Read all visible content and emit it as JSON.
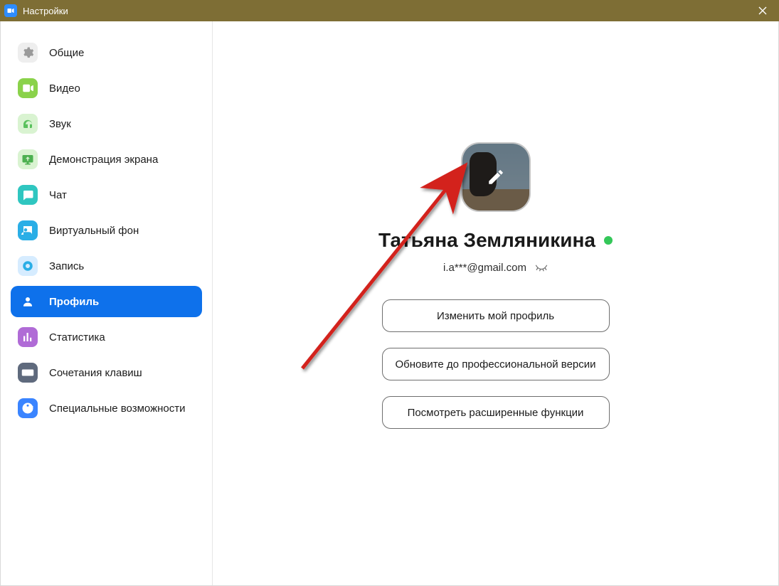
{
  "window": {
    "title": "Настройки"
  },
  "sidebar": {
    "items": [
      {
        "id": "general",
        "label": "Общие",
        "icon": "gear",
        "color": "#eeeeee",
        "glyph": "#9a9a9a"
      },
      {
        "id": "video",
        "label": "Видео",
        "icon": "video",
        "color": "#8ad24a",
        "glyph": "#ffffff"
      },
      {
        "id": "audio",
        "label": "Звук",
        "icon": "headphones",
        "color": "#d9f3d1",
        "glyph": "#59c15c"
      },
      {
        "id": "share",
        "label": "Демонстрация экрана",
        "icon": "share-screen",
        "color": "#d9f3d1",
        "glyph": "#4cb050"
      },
      {
        "id": "chat",
        "label": "Чат",
        "icon": "chat",
        "color": "#2fc6c0",
        "glyph": "#ffffff"
      },
      {
        "id": "vbg",
        "label": "Виртуальный фон",
        "icon": "virtual-bg",
        "color": "#2aaee6",
        "glyph": "#ffffff"
      },
      {
        "id": "record",
        "label": "Запись",
        "icon": "record",
        "color": "#d6ecff",
        "glyph": "#2aaee6"
      },
      {
        "id": "profile",
        "label": "Профиль",
        "icon": "profile",
        "color": "#ffffff",
        "glyph": "#ffffff",
        "active": true
      },
      {
        "id": "stats",
        "label": "Статистика",
        "icon": "stats",
        "color": "#b06bd6",
        "glyph": "#ffffff"
      },
      {
        "id": "shortcuts",
        "label": "Сочетания клавиш",
        "icon": "keyboard",
        "color": "#5f6a7d",
        "glyph": "#ffffff"
      },
      {
        "id": "accessibility",
        "label": "Специальные возможности",
        "icon": "accessibility",
        "color": "#3a84ff",
        "glyph": "#ffffff"
      }
    ]
  },
  "profile": {
    "display_name": "Татьяна Земляникина",
    "email": "i.a***@gmail.com",
    "status": "online",
    "buttons": {
      "edit": "Изменить мой профиль",
      "upgrade": "Обновите до профессиональной версии",
      "advanced": "Посмотреть расширенные функции"
    }
  }
}
